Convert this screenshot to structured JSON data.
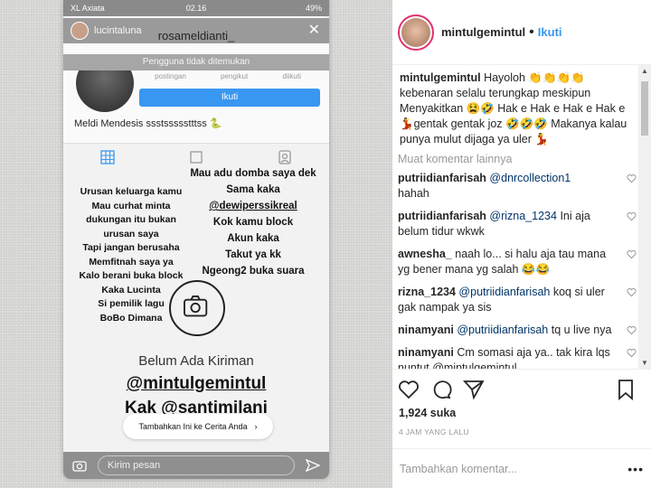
{
  "story": {
    "status_carrier": "XL Axiata",
    "status_time": "02.16",
    "status_battery": "49%",
    "story_user": "lucintaluna",
    "profile_name": "rosameldianti_",
    "not_found": "Pengguna tidak ditemukan",
    "stats": [
      "postingan",
      "pengikut",
      "diikuti"
    ],
    "follow_label": "Ikuti",
    "bio_name": "Meldi Mendesis ssstssssstttss 🐍",
    "text_left": [
      "Urusan keluarga kamu",
      "Mau curhat minta",
      "dukungan itu bukan",
      "urusan saya",
      "Tapi jangan berusaha",
      "Memfitnah saya ya",
      "Kalo berani buka block",
      "Kaka Lucinta",
      "Si pemilik lagu",
      "BoBo Dimana"
    ],
    "text_right": [
      "Mau adu domba saya dek",
      "Sama kaka",
      "@dewiperssikreal",
      "Kok kamu block",
      "Akun kaka",
      "Takut ya kk",
      "Ngeong2 buka suara"
    ],
    "no_posts": "Belum Ada Kiriman",
    "mention_1": "@mintulgemintul",
    "mention_2": "Kak @santimilani",
    "add_story": "Tambahkan Ini ke Cerita Anda",
    "message_placeholder": "Kirim pesan"
  },
  "post": {
    "username": "mintulgemintul",
    "dot": "•",
    "follow_label": "Ikuti",
    "caption_user": "mintulgemintul",
    "caption_text": "Hayoloh 👏👏👏👏 kebenaran selalu terungkap meskipun Menyakitkan 😫🤣 Hak e Hak e Hak e Hak e 💃gentak gentak joz 🤣🤣🤣 Makanya kalau punya mulut dijaga ya uler 💃",
    "load_more": "Muat komentar lainnya",
    "comments": [
      {
        "user": "putriidianfarisah",
        "mention": "@dnrcollection1",
        "text": "hahah"
      },
      {
        "user": "putriidianfarisah",
        "mention": "@rizna_1234",
        "text": "Ini aja belum tidur wkwk"
      },
      {
        "user": "awnesha_",
        "mention": "",
        "text": "naah lo... si halu aja tau mana yg bener mana yg salah 😂😂"
      },
      {
        "user": "rizna_1234",
        "mention": "@putriidianfarisah",
        "text": "koq si uler gak nampak ya sis"
      },
      {
        "user": "ninamyani",
        "mention": "@putriidianfarisah",
        "text": "tq u live nya"
      },
      {
        "user": "ninamyani",
        "mention": "",
        "text": "Cm somasi aja ya.. tak kira lqs nuntut @mintulgemintul"
      }
    ],
    "likes": "1,924 suka",
    "time_ago": "4 JAM YANG LALU",
    "comment_placeholder": "Tambahkan komentar...",
    "more": "•••"
  }
}
